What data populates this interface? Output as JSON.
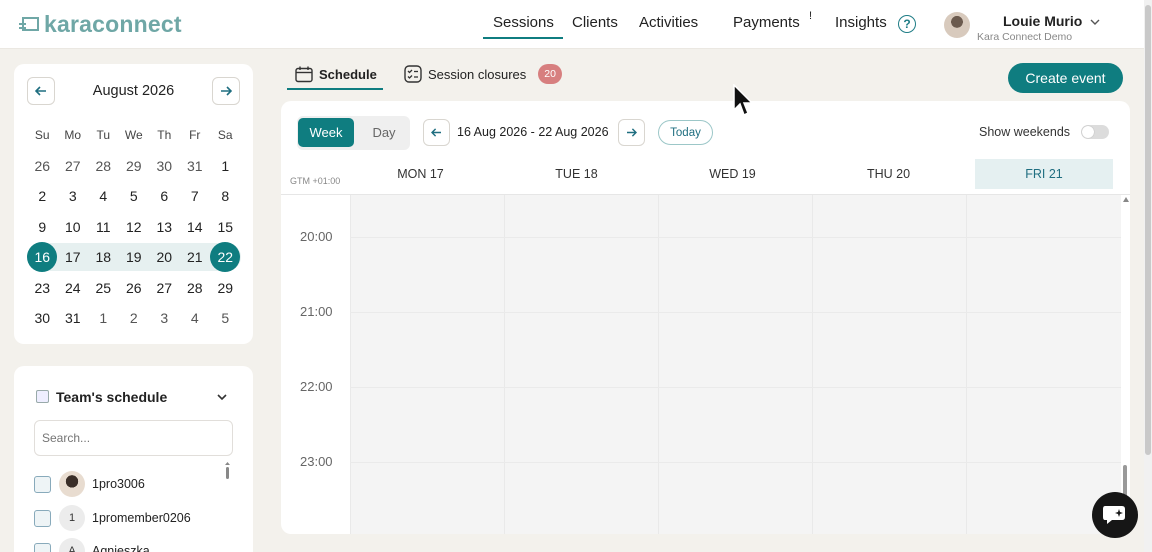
{
  "brand": {
    "name": "karaconnect",
    "color": "#6fa7a6",
    "accent": "#0f7d80"
  },
  "nav": {
    "items": [
      {
        "label": "Sessions",
        "active": true
      },
      {
        "label": "Clients"
      },
      {
        "label": "Activities"
      },
      {
        "label": "Payments",
        "marker": "!"
      },
      {
        "label": "Insights"
      }
    ],
    "help_icon": "question-circle-icon"
  },
  "user": {
    "name": "Louie Murio",
    "subtitle": "Kara Connect Demo"
  },
  "mini_calendar": {
    "month_label": "August 2026",
    "weekdays": [
      "Su",
      "Mo",
      "Tu",
      "We",
      "Th",
      "Fr",
      "Sa"
    ],
    "weeks": [
      [
        "26",
        "27",
        "28",
        "29",
        "30",
        "31",
        "1"
      ],
      [
        "2",
        "3",
        "4",
        "5",
        "6",
        "7",
        "8"
      ],
      [
        "9",
        "10",
        "11",
        "12",
        "13",
        "14",
        "15"
      ],
      [
        "16",
        "17",
        "18",
        "19",
        "20",
        "21",
        "22"
      ],
      [
        "23",
        "24",
        "25",
        "26",
        "27",
        "28",
        "29"
      ],
      [
        "30",
        "31",
        "1",
        "2",
        "3",
        "4",
        "5"
      ]
    ]
  },
  "team": {
    "title": "Team's schedule",
    "search_placeholder": "Search...",
    "members": [
      {
        "name": "1pro3006",
        "initial": ""
      },
      {
        "name": "1promember0206",
        "initial": "1"
      },
      {
        "name": "Agnieszka",
        "initial": "A"
      }
    ]
  },
  "tabs": {
    "schedule": "Schedule",
    "closures": "Session closures",
    "closures_count": "20"
  },
  "create_event": "Create event",
  "toolbar": {
    "week": "Week",
    "day": "Day",
    "range": "16 Aug 2026 - 22 Aug 2026",
    "today": "Today",
    "show_weekends": "Show weekends"
  },
  "timezone": "GTM +01:00",
  "days": [
    {
      "label": "MON 17"
    },
    {
      "label": "TUE 18"
    },
    {
      "label": "WED 19"
    },
    {
      "label": "THU 20"
    },
    {
      "label": "FRI 21",
      "highlight": true
    }
  ],
  "times": [
    "20:00",
    "21:00",
    "22:00",
    "23:00"
  ]
}
